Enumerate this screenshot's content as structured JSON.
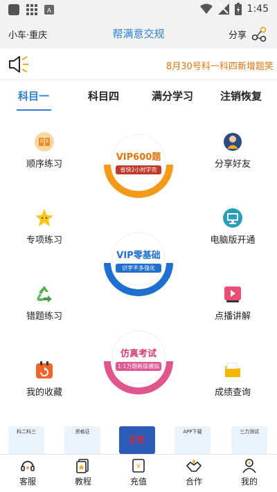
{
  "status_bar": {
    "time": "1:45"
  },
  "header": {
    "location": "小车·重庆",
    "title": "帮满意交规",
    "share_label": "分享"
  },
  "notice": {
    "text": "8月30号科一科四新增题笑"
  },
  "tabs": [
    {
      "label": "科目一",
      "active": true
    },
    {
      "label": "科目四",
      "active": false
    },
    {
      "label": "满分学习",
      "active": false
    },
    {
      "label": "注销恢复",
      "active": false
    }
  ],
  "left_features": [
    {
      "label": "顺序练习",
      "icon": "book-icon"
    },
    {
      "label": "专项练习",
      "icon": "star-icon"
    },
    {
      "label": "错题练习",
      "icon": "recycle-icon"
    },
    {
      "label": "我的收藏",
      "icon": "calendar-icon"
    }
  ],
  "right_features": [
    {
      "label": "分享好友",
      "icon": "person-icon"
    },
    {
      "label": "电脑版开通",
      "icon": "monitor-icon"
    },
    {
      "label": "点播讲解",
      "icon": "video-icon"
    },
    {
      "label": "成绩查询",
      "icon": "folder-icon"
    }
  ],
  "center_buttons": [
    {
      "title": "VIP600题",
      "tag": "省快2小时学完",
      "color": "#f5a623"
    },
    {
      "title": "VIP零基础",
      "tag": "识字不多强化",
      "color": "#2e7fd6"
    },
    {
      "title": "仿真考试",
      "tag": "1:1万题新版模拟",
      "color": "#e0558c"
    }
  ],
  "ads": [
    {
      "label": "科二科三"
    },
    {
      "label": "资格证"
    },
    {
      "label": "正在"
    },
    {
      "label": "APP下载"
    },
    {
      "label": "三力测试"
    }
  ],
  "bottom_nav": [
    {
      "label": "客服",
      "icon": "headset-icon"
    },
    {
      "label": "教程",
      "icon": "tutorial-icon"
    },
    {
      "label": "充值",
      "icon": "recharge-icon"
    },
    {
      "label": "合作",
      "icon": "handshake-icon"
    },
    {
      "label": "我的",
      "icon": "user-icon"
    }
  ],
  "colors": {
    "accent": "#2e7fd6",
    "notice": "#e8730a"
  }
}
